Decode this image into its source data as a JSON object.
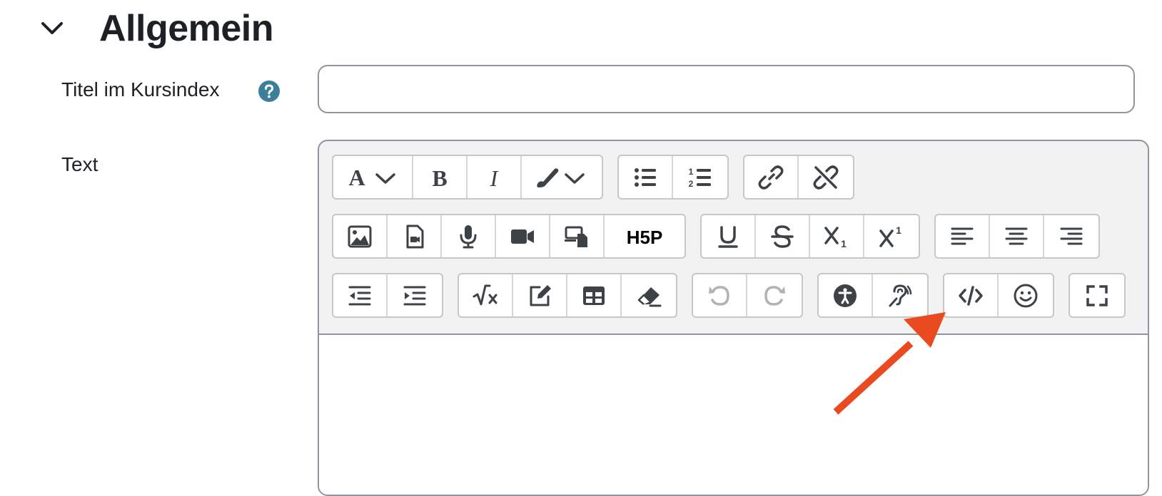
{
  "section": {
    "title": "Allgemein",
    "collapse_icon": "chevron-down-icon"
  },
  "fields": {
    "title_label": "Titel im Kursindex",
    "title_value": "",
    "help_icon": "question-circle-icon",
    "text_label": "Text"
  },
  "toolbar_rows": [
    [
      [
        "font-style-icon",
        "bold-icon",
        "italic-icon",
        "text-color-icon"
      ],
      [
        "bullet-list-icon",
        "numbered-list-icon"
      ],
      [
        "link-icon",
        "unlink-icon"
      ]
    ],
    [
      [
        "image-icon",
        "media-file-icon",
        "audio-record-icon",
        "video-record-icon",
        "responsive-media-icon",
        "h5p-icon"
      ],
      [
        "underline-icon",
        "strikethrough-icon",
        "subscript-icon",
        "superscript-icon"
      ],
      [
        "align-left-icon",
        "align-center-icon",
        "align-right-icon"
      ]
    ],
    [
      [
        "outdent-icon",
        "indent-icon"
      ],
      [
        "equation-icon",
        "edit-icon",
        "table-icon",
        "eraser-icon"
      ],
      [
        "undo-icon",
        "redo-icon"
      ],
      [
        "accessibility-checker-icon",
        "screen-reader-icon"
      ],
      [
        "code-icon",
        "emoji-icon"
      ],
      [
        "fullscreen-icon"
      ]
    ]
  ],
  "h5p_text": "H5P",
  "colors": {
    "accent": "#3d7f9a",
    "arrow": "#ea4a1f",
    "icon": "#3d4246"
  }
}
